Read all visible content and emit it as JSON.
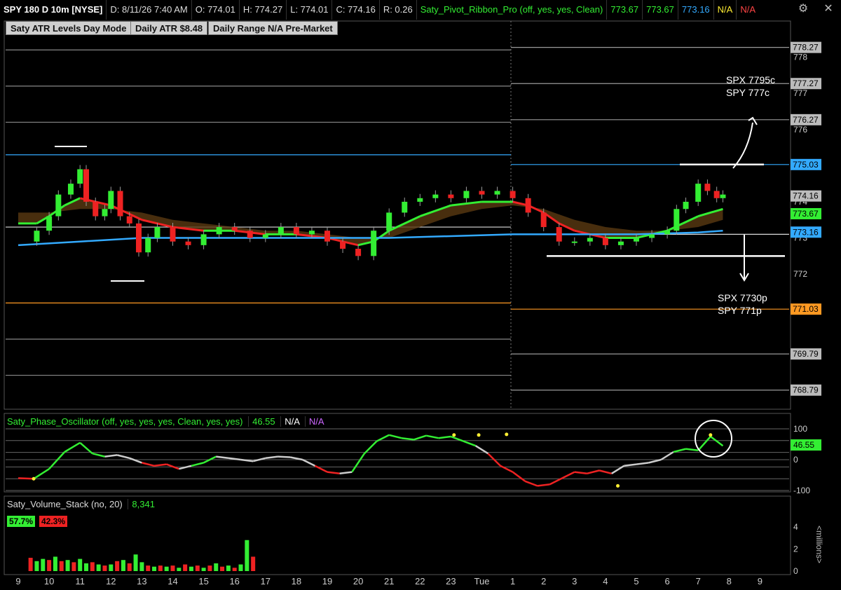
{
  "header": {
    "symbol": "SPY 180 D 10m [NYSE]",
    "date": "D: 8/11/26 7:40 AM",
    "open": "O: 774.01",
    "high": "H: 774.27",
    "low": "L: 774.01",
    "close": "C: 774.16",
    "range": "R: 0.26",
    "study": "Saty_Pivot_Ribbon_Pro (off, yes, yes, Clean)",
    "v1": "773.67",
    "v2": "773.67",
    "v3": "773.16",
    "v4": "N/A",
    "v5": "N/A"
  },
  "buttons": {
    "b1": "Saty ATR Levels Day Mode",
    "b2": "Daily ATR $8.48",
    "b3": "Daily Range N/A Pre-Market"
  },
  "colors": {
    "green": "#33ee33",
    "red": "#ee2222",
    "blue": "#33aaff",
    "orange": "#ff9922",
    "gray": "#bbbbbb",
    "white": "#ffffff",
    "purple": "#cc66ff",
    "yellow": "#ffee33"
  },
  "annotations": {
    "spx_up": "SPX 7795c",
    "spy_up": "SPY 777c",
    "spx_dn": "SPX 7730p",
    "spy_dn": "SPY 771p"
  },
  "oscillator": {
    "title": "Saty_Phase_Oscillator (off, yes, yes, yes, Clean, yes, yes)",
    "value": "46.55",
    "na1": "N/A",
    "na2": "N/A"
  },
  "volume": {
    "title": "Saty_Volume_Stack (no, 20)",
    "value": "8,341",
    "buy_pct": "57.7%",
    "sell_pct": "42.3%",
    "unit": "<millions>"
  },
  "chart_data": [
    {
      "type": "line",
      "panel": "price",
      "ylim": [
        768.3,
        779.0
      ],
      "yticks": [
        772,
        773,
        774,
        775,
        776,
        777,
        778
      ],
      "ytick_labels": [
        "772",
        "773",
        "774",
        "775",
        "776",
        "777",
        "778"
      ],
      "prev_day_levels": [
        778.2,
        777.2,
        776.2,
        775.3,
        773.3,
        771.2,
        770.2,
        769.2
      ],
      "today_levels": [
        778.27,
        777.27,
        776.27,
        775.03,
        773.1,
        771.03,
        769.79,
        768.79
      ],
      "level_badges": [
        {
          "label": "778.27",
          "value": 778.27,
          "color": "#bbbbbb"
        },
        {
          "label": "777.27",
          "value": 777.27,
          "color": "#bbbbbb"
        },
        {
          "label": "776.27",
          "value": 776.27,
          "color": "#bbbbbb"
        },
        {
          "label": "775.03",
          "value": 775.03,
          "color": "#33aaff"
        },
        {
          "label": "774.16",
          "value": 774.16,
          "color": "#bbbbbb"
        },
        {
          "label": "773.67",
          "value": 773.67,
          "color": "#33ee33"
        },
        {
          "label": "773.16",
          "value": 773.16,
          "color": "#33aaff"
        },
        {
          "label": "771.03",
          "value": 771.03,
          "color": "#ff9922"
        },
        {
          "label": "769.79",
          "value": 769.79,
          "color": "#bbbbbb"
        },
        {
          "label": "768.79",
          "value": 768.79,
          "color": "#bbbbbb"
        }
      ],
      "x_ticks": [
        "9",
        "10",
        "11",
        "12",
        "13",
        "14",
        "15",
        "16",
        "17",
        "18",
        "19",
        "20",
        "21",
        "22",
        "23",
        "Tue",
        "1",
        "2",
        "3",
        "4",
        "5",
        "6",
        "7",
        "8",
        "9"
      ],
      "price_path": [
        [
          0,
          772.9
        ],
        [
          0.6,
          773.2
        ],
        [
          1.0,
          773.6
        ],
        [
          1.3,
          774.2
        ],
        [
          1.7,
          774.5
        ],
        [
          2.0,
          774.9
        ],
        [
          2.2,
          774.0
        ],
        [
          2.5,
          773.6
        ],
        [
          2.8,
          773.8
        ],
        [
          3.0,
          774.3
        ],
        [
          3.3,
          773.6
        ],
        [
          3.6,
          773.4
        ],
        [
          3.9,
          772.6
        ],
        [
          4.2,
          773.0
        ],
        [
          4.5,
          773.3
        ],
        [
          5.0,
          772.9
        ],
        [
          5.5,
          772.8
        ],
        [
          6.0,
          773.1
        ],
        [
          6.5,
          773.3
        ],
        [
          7.0,
          773.2
        ],
        [
          7.5,
          773.0
        ],
        [
          8.0,
          773.1
        ],
        [
          8.5,
          773.3
        ],
        [
          9.0,
          773.1
        ],
        [
          9.5,
          773.2
        ],
        [
          10.0,
          772.9
        ],
        [
          10.5,
          772.7
        ],
        [
          11.0,
          772.5
        ],
        [
          11.5,
          773.2
        ],
        [
          12.0,
          773.7
        ],
        [
          12.5,
          774.0
        ],
        [
          13.0,
          774.1
        ],
        [
          13.5,
          774.2
        ],
        [
          14.0,
          774.1
        ],
        [
          14.5,
          774.3
        ],
        [
          15.0,
          774.2
        ],
        [
          15.5,
          774.3
        ],
        [
          16.0,
          774.1
        ],
        [
          16.5,
          773.7
        ],
        [
          17.0,
          773.3
        ],
        [
          17.5,
          772.9
        ],
        [
          18.0,
          772.9
        ],
        [
          18.5,
          773.0
        ],
        [
          19.0,
          772.8
        ],
        [
          19.5,
          772.9
        ],
        [
          20.0,
          773.0
        ],
        [
          20.5,
          773.1
        ],
        [
          21.0,
          773.2
        ],
        [
          21.3,
          773.8
        ],
        [
          21.6,
          774.0
        ],
        [
          22.0,
          774.5
        ],
        [
          22.3,
          774.3
        ],
        [
          22.6,
          774.1
        ],
        [
          22.8,
          774.2
        ]
      ],
      "ribbon_fast": [
        [
          0,
          773.4
        ],
        [
          0.6,
          773.4
        ],
        [
          1.0,
          773.6
        ],
        [
          1.5,
          773.9
        ],
        [
          2.0,
          774.1
        ],
        [
          2.5,
          774.0
        ],
        [
          3.0,
          773.9
        ],
        [
          3.5,
          773.7
        ],
        [
          4.0,
          773.5
        ],
        [
          5.0,
          773.3
        ],
        [
          6.0,
          773.2
        ],
        [
          7.0,
          773.2
        ],
        [
          8.0,
          773.1
        ],
        [
          9.0,
          773.1
        ],
        [
          10.0,
          773.0
        ],
        [
          11.0,
          772.8
        ],
        [
          11.5,
          772.9
        ],
        [
          12.0,
          773.2
        ],
        [
          13.0,
          773.6
        ],
        [
          14.0,
          773.9
        ],
        [
          15.0,
          774.0
        ],
        [
          16.0,
          774.0
        ],
        [
          16.5,
          773.9
        ],
        [
          17.0,
          773.7
        ],
        [
          17.5,
          773.4
        ],
        [
          18.0,
          773.2
        ],
        [
          19.0,
          773.0
        ],
        [
          20.0,
          773.0
        ],
        [
          21.0,
          773.2
        ],
        [
          21.5,
          773.4
        ],
        [
          22.0,
          773.6
        ],
        [
          22.8,
          773.8
        ]
      ],
      "ribbon_slow": [
        [
          0,
          773.7
        ],
        [
          1.0,
          773.7
        ],
        [
          2.0,
          773.8
        ],
        [
          3.0,
          773.8
        ],
        [
          4.0,
          773.7
        ],
        [
          5.0,
          773.5
        ],
        [
          6.0,
          773.4
        ],
        [
          7.0,
          773.3
        ],
        [
          8.0,
          773.2
        ],
        [
          9.0,
          773.2
        ],
        [
          10.0,
          773.1
        ],
        [
          11.0,
          773.0
        ],
        [
          12.0,
          773.0
        ],
        [
          13.0,
          773.3
        ],
        [
          14.0,
          773.6
        ],
        [
          15.0,
          773.8
        ],
        [
          16.0,
          773.9
        ],
        [
          17.0,
          773.8
        ],
        [
          18.0,
          773.5
        ],
        [
          19.0,
          773.3
        ],
        [
          20.0,
          773.2
        ],
        [
          21.0,
          773.2
        ],
        [
          22.0,
          773.3
        ],
        [
          22.8,
          773.5
        ]
      ],
      "trend_line": [
        [
          0,
          772.8
        ],
        [
          2.0,
          772.9
        ],
        [
          4.0,
          773.0
        ],
        [
          6.0,
          773.0
        ],
        [
          8.0,
          773.0
        ],
        [
          10.0,
          773.0
        ],
        [
          12.0,
          773.0
        ],
        [
          14.0,
          773.05
        ],
        [
          16.0,
          773.1
        ],
        [
          18.0,
          773.1
        ],
        [
          20.0,
          773.1
        ],
        [
          22.0,
          773.15
        ],
        [
          22.8,
          773.2
        ]
      ]
    },
    {
      "type": "line",
      "panel": "oscillator",
      "ylim": [
        -100,
        100
      ],
      "yticks": [
        -100,
        0,
        100
      ],
      "ytick_labels": [
        "-100",
        "0",
        "100"
      ],
      "levels": [
        100,
        61.8,
        23.6,
        0,
        -23.6,
        -61.8,
        -100
      ],
      "x": [
        0,
        0.5,
        1,
        1.5,
        2,
        2.4,
        2.8,
        3.2,
        3.6,
        4.0,
        4.4,
        4.8,
        5.2,
        5.6,
        6.0,
        6.4,
        6.8,
        7.2,
        7.6,
        8.0,
        8.4,
        8.8,
        9.2,
        9.6,
        10.0,
        10.4,
        10.8,
        11.2,
        11.6,
        12.0,
        12.4,
        12.8,
        13.2,
        13.6,
        14.0,
        14.4,
        14.8,
        15.2,
        15.6,
        16.0,
        16.4,
        16.8,
        17.2,
        17.6,
        18.0,
        18.4,
        18.8,
        19.2,
        19.6,
        20.0,
        20.4,
        20.8,
        21.2,
        21.6,
        22.0,
        22.4,
        22.8
      ],
      "values": [
        -60,
        -62,
        -30,
        25,
        55,
        20,
        10,
        15,
        5,
        -10,
        -20,
        -15,
        -30,
        -20,
        -10,
        10,
        5,
        0,
        -5,
        5,
        10,
        8,
        0,
        -20,
        -40,
        -45,
        -40,
        20,
        60,
        80,
        70,
        65,
        78,
        70,
        75,
        60,
        45,
        20,
        -20,
        -40,
        -70,
        -85,
        -80,
        -60,
        -40,
        -45,
        -35,
        -45,
        -20,
        -15,
        -10,
        0,
        25,
        35,
        30,
        75,
        45
      ],
      "colors": [
        "r",
        "r",
        "g",
        "g",
        "g",
        "g",
        "g",
        "w",
        "w",
        "w",
        "r",
        "r",
        "r",
        "w",
        "g",
        "g",
        "w",
        "w",
        "w",
        "w",
        "w",
        "w",
        "w",
        "w",
        "r",
        "r",
        "w",
        "g",
        "g",
        "g",
        "g",
        "g",
        "g",
        "g",
        "g",
        "g",
        "g",
        "w",
        "r",
        "r",
        "r",
        "r",
        "r",
        "r",
        "r",
        "r",
        "r",
        "r",
        "w",
        "w",
        "w",
        "w",
        "w",
        "g",
        "g",
        "g",
        "g"
      ],
      "dots": [
        [
          0.5,
          -62
        ],
        [
          14.1,
          80
        ],
        [
          14.9,
          80
        ],
        [
          15.8,
          82
        ],
        [
          19.4,
          -85
        ],
        [
          22.4,
          80
        ]
      ]
    },
    {
      "type": "bar",
      "panel": "volume",
      "ylim": [
        0,
        5
      ],
      "yticks": [
        0,
        2,
        4
      ],
      "ytick_labels": [
        "0",
        "2",
        "4"
      ],
      "x": [
        0.4,
        0.6,
        0.8,
        1.0,
        1.2,
        1.4,
        1.6,
        1.8,
        2.0,
        2.2,
        2.4,
        2.6,
        2.8,
        3.0,
        3.2,
        3.4,
        3.6,
        3.8,
        4.0,
        4.2,
        4.4,
        4.6,
        4.8,
        5.0,
        5.2,
        5.4,
        5.6,
        5.8,
        6.0,
        6.2,
        6.4,
        6.6,
        6.8,
        7.0,
        7.2,
        7.4,
        7.6
      ],
      "values": [
        1.2,
        0.9,
        1.1,
        1.0,
        1.3,
        0.9,
        1.0,
        0.8,
        1.1,
        0.7,
        0.8,
        0.6,
        0.5,
        0.6,
        0.9,
        1.0,
        0.7,
        1.5,
        0.8,
        0.5,
        0.4,
        0.5,
        0.4,
        0.5,
        0.3,
        0.6,
        0.4,
        0.5,
        0.3,
        0.5,
        0.7,
        0.4,
        0.5,
        0.3,
        0.6,
        2.8,
        1.3
      ],
      "colors": [
        "r",
        "g",
        "g",
        "r",
        "g",
        "r",
        "g",
        "r",
        "g",
        "g",
        "r",
        "g",
        "r",
        "g",
        "r",
        "g",
        "r",
        "g",
        "g",
        "r",
        "g",
        "r",
        "g",
        "r",
        "g",
        "r",
        "g",
        "r",
        "g",
        "r",
        "g",
        "r",
        "g",
        "r",
        "g",
        "g",
        "r"
      ]
    }
  ]
}
